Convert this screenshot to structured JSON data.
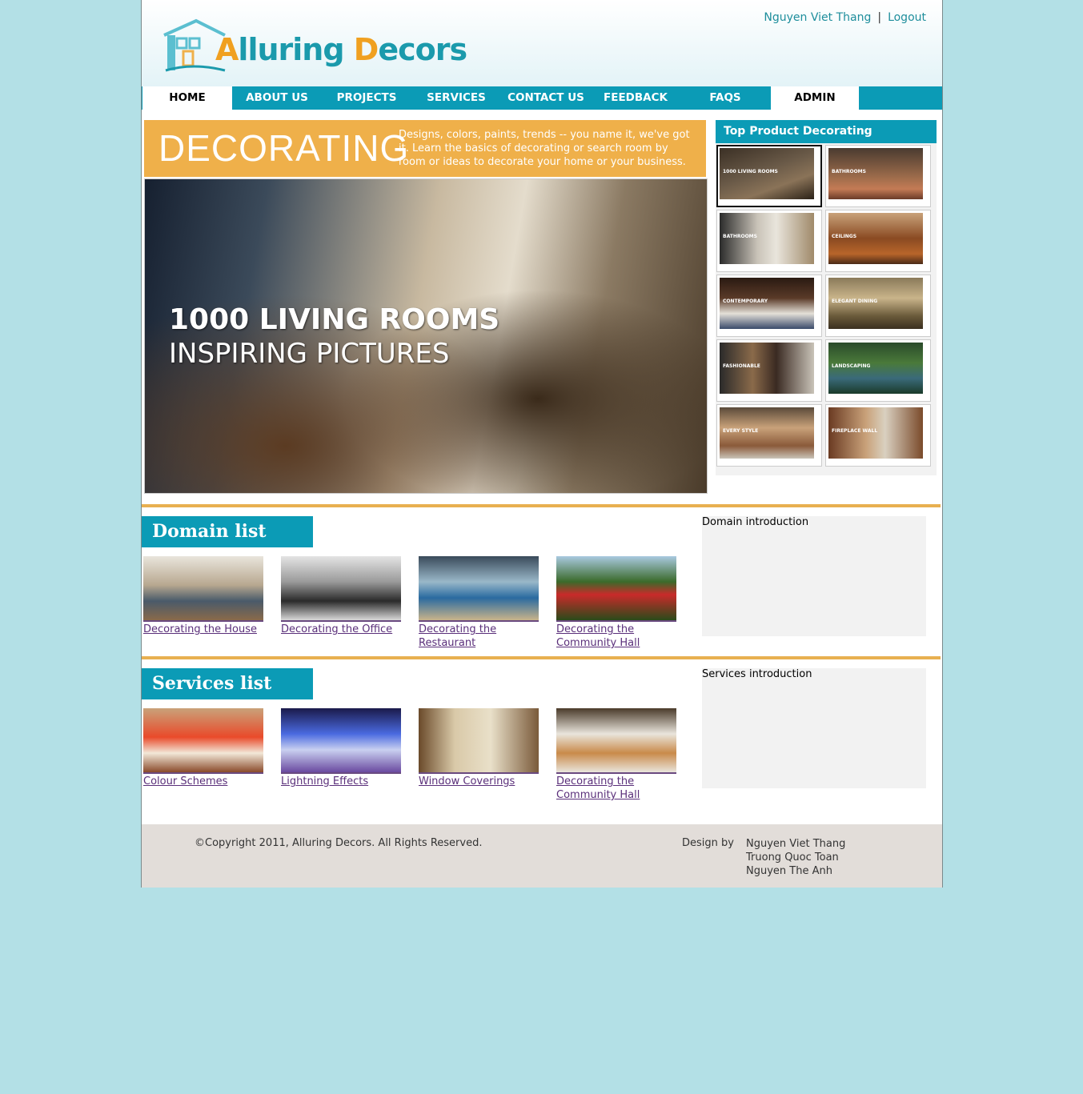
{
  "brand": {
    "first": "A",
    "rest1": "lluring ",
    "second": "D",
    "rest2": "ecors"
  },
  "user": {
    "name": "Nguyen Viet Thang",
    "separator": "|",
    "logout": "Logout"
  },
  "nav": [
    {
      "label": "HOME",
      "active": true
    },
    {
      "label": "ABOUT US"
    },
    {
      "label": "PROJECTS"
    },
    {
      "label": "SERVICES"
    },
    {
      "label": "CONTACT US"
    },
    {
      "label": "FEEDBACK"
    },
    {
      "label": "FAQS"
    },
    {
      "label": "ADMIN",
      "active": true
    }
  ],
  "hero": {
    "title": "DECORATING",
    "description": "Designs, colors, paints, trends -- you name it, we've got it. Learn the basics of decorating or search room by room or ideas to decorate your home or your business.",
    "image_caption_1": "1000 LIVING ROOMS",
    "image_caption_2": "INSPIRING PICTURES"
  },
  "side": {
    "title": "Top Product Decorating",
    "thumbs": [
      {
        "label": "1000 LIVING ROOMS"
      },
      {
        "label": "BATHROOMS"
      },
      {
        "label": "BATHROOMS"
      },
      {
        "label": "CEILINGS"
      },
      {
        "label": "CONTEMPORARY"
      },
      {
        "label": "ELEGANT DINING"
      },
      {
        "label": "FASHIONABLE"
      },
      {
        "label": "LANDSCAPING"
      },
      {
        "label": "EVERY STYLE"
      },
      {
        "label": "FIREPLACE WALL"
      }
    ]
  },
  "domain": {
    "heading": "Domain list",
    "intro": "Domain introduction",
    "items": [
      {
        "label": "Decorating the House"
      },
      {
        "label": "Decorating the Office"
      },
      {
        "label": "Decorating the Restaurant"
      },
      {
        "label": "Decorating the Community Hall"
      }
    ]
  },
  "services": {
    "heading": "Services list",
    "intro": "Services introduction",
    "items": [
      {
        "label": "Colour Schemes"
      },
      {
        "label": "Lightning Effects"
      },
      {
        "label": "Window Coverings"
      },
      {
        "label": "Decorating the Community Hall"
      }
    ]
  },
  "footer": {
    "copyright": "©Copyright 2011, Alluring Decors. All Rights Reserved.",
    "design_by": "Design by",
    "designers": [
      "Nguyen Viet Thang",
      "Truong Quoc Toan",
      "Nguyen The Anh"
    ]
  },
  "colors": {
    "background": "#b3e0e6",
    "teal": "#0b9bb6",
    "orange": "#efb04a",
    "link": "#5a2f7a"
  }
}
